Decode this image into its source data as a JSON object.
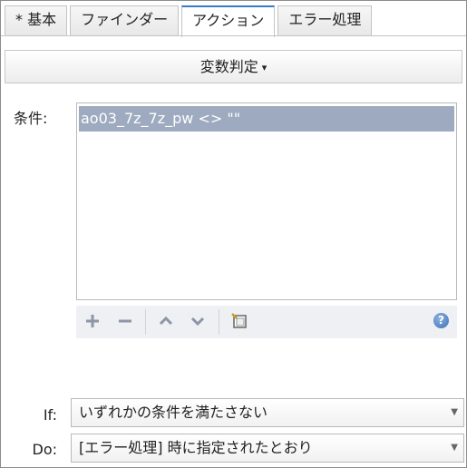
{
  "tabs": [
    {
      "label": "* 基本"
    },
    {
      "label": "ファインダー"
    },
    {
      "label": "アクション"
    },
    {
      "label": "エラー処理"
    }
  ],
  "action": {
    "label": "変数判定",
    "caret": "▾"
  },
  "conditions": {
    "label": "条件:",
    "items": [
      "ao03_7z_7z_pw <> \"\""
    ]
  },
  "toolbar": {
    "icons": [
      "plus-icon",
      "minus-icon",
      "up-icon",
      "down-icon",
      "note-icon",
      "help-icon"
    ]
  },
  "if_field": {
    "label": "If:",
    "value": "いずれかの条件を満たさない"
  },
  "do_field": {
    "label": "Do:",
    "value": "[エラー処理] 時に指定されたとおり"
  }
}
